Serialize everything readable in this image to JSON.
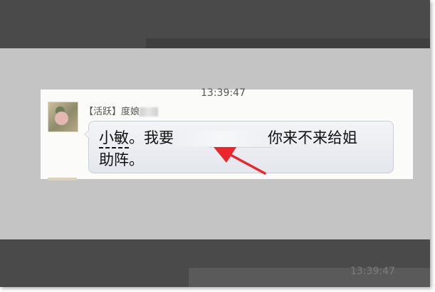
{
  "header": {
    "timestamp": "13:39:47"
  },
  "message": {
    "sender_tag": "【活跃】",
    "sender_name": "度娘",
    "text_line1_name": "小敏",
    "text_line1_mid": "。我要",
    "text_line1_end": "你来不来给姐",
    "text_line2": "助阵。"
  },
  "footer": {
    "ghost_timestamp": "13:39:47"
  },
  "colors": {
    "dark_band": "#4a4a4a",
    "overlay": "#c4c4c4",
    "bubble": "#eceef3",
    "arrow": "#e8262b"
  },
  "icons": {
    "avatar": "avatar-image",
    "annotation": "red-arrow-icon"
  }
}
